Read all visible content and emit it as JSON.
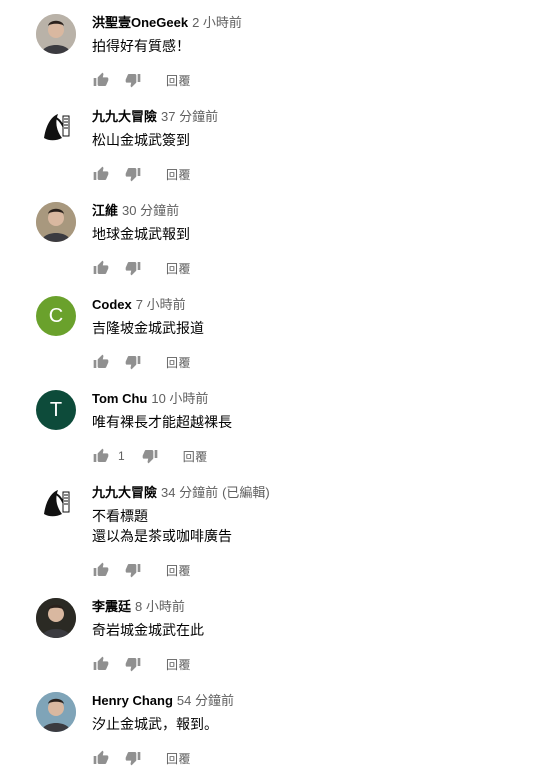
{
  "comments": [
    {
      "author": "洪聖壹OneGeek",
      "time": "2 小時前",
      "edited": "",
      "text": [
        "拍得好有質感！"
      ],
      "likes": "",
      "reply": "回覆",
      "avatar_letter": "",
      "avatar_color": "#b9b2a8",
      "avatar_icon": "person-photo"
    },
    {
      "author": "九九大冒險",
      "time": "37 分鐘前",
      "edited": "",
      "text": [
        "松山金城武簽到"
      ],
      "likes": "",
      "reply": "回覆",
      "avatar_letter": "",
      "avatar_color": "#ffffff",
      "avatar_icon": "ink-logo"
    },
    {
      "author": "江維",
      "time": "30 分鐘前",
      "edited": "",
      "text": [
        "地球金城武報到"
      ],
      "likes": "",
      "reply": "回覆",
      "avatar_letter": "",
      "avatar_color": "#a8987e",
      "avatar_icon": "person-photo"
    },
    {
      "author": "Codex",
      "time": "7 小時前",
      "edited": "",
      "text": [
        "吉隆坡金城武报道"
      ],
      "likes": "",
      "reply": "回覆",
      "avatar_letter": "C",
      "avatar_color": "#6aa12c",
      "avatar_icon": "letter"
    },
    {
      "author": "Tom Chu",
      "time": "10 小時前",
      "edited": "",
      "text": [
        "唯有裸長才能超越裸長"
      ],
      "likes": "1",
      "reply": "回覆",
      "avatar_letter": "T",
      "avatar_color": "#0d4b3a",
      "avatar_icon": "letter"
    },
    {
      "author": "九九大冒險",
      "time": "34 分鐘前",
      "edited": "(已編輯)",
      "text": [
        "不看標題",
        "還以為是茶或咖啡廣告"
      ],
      "likes": "",
      "reply": "回覆",
      "avatar_letter": "",
      "avatar_color": "#ffffff",
      "avatar_icon": "ink-logo"
    },
    {
      "author": "李震廷",
      "time": "8 小時前",
      "edited": "",
      "text": [
        "奇岩城金城武在此"
      ],
      "likes": "",
      "reply": "回覆",
      "avatar_letter": "",
      "avatar_color": "#2b2a24",
      "avatar_icon": "person-photo"
    },
    {
      "author": "Henry Chang",
      "time": "54 分鐘前",
      "edited": "",
      "text": [
        "汐止金城武，報到。"
      ],
      "likes": "",
      "reply": "回覆",
      "avatar_letter": "",
      "avatar_color": "#7fa4b8",
      "avatar_icon": "person-photo"
    }
  ]
}
